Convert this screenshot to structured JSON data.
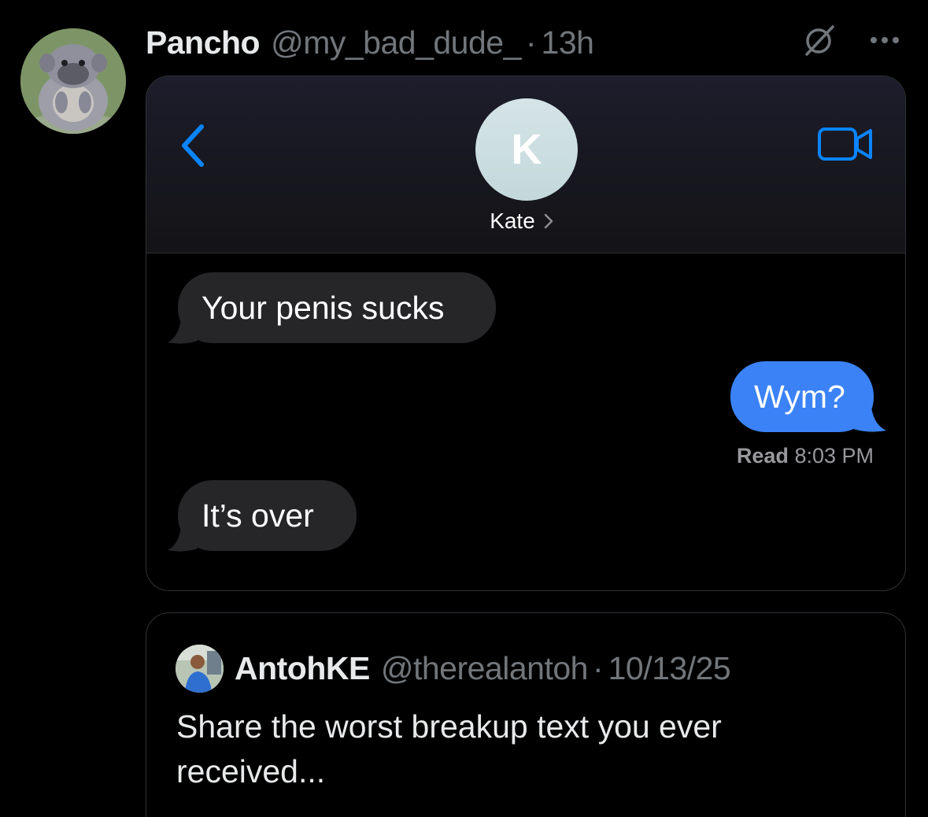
{
  "post": {
    "author": {
      "display_name": "Pancho",
      "handle": "@my_bad_dude_",
      "time": "13h",
      "avatar_icon": "monkey-avatar"
    },
    "separator": "·",
    "icons": {
      "grok": "grok-icon",
      "more": "more-icon"
    }
  },
  "media": {
    "conversation": {
      "contact_initial": "K",
      "contact_name": "Kate",
      "messages": [
        {
          "direction": "incoming",
          "text": "Your penis sucks"
        },
        {
          "direction": "outgoing",
          "text": "Wym?"
        },
        {
          "direction": "incoming",
          "text": "It’s over"
        }
      ],
      "read_receipt": {
        "label": "Read",
        "time": "8:03 PM"
      },
      "colors": {
        "outgoing_bubble": "#3b82f6",
        "incoming_bubble": "#262629",
        "accent": "#0a84ff"
      }
    }
  },
  "quoted_post": {
    "display_name": "AntohKE",
    "handle": "@therealantoh",
    "date": "10/13/25",
    "text": "Share the worst breakup text you ever received..."
  }
}
